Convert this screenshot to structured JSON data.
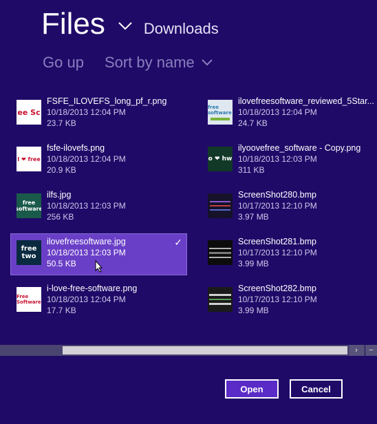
{
  "header": {
    "title": "Files",
    "location": "Downloads"
  },
  "toolbar": {
    "go_up": "Go up",
    "sort": "Sort by name"
  },
  "files_left": [
    {
      "name": "FSFE_ILOVEFS_long_pf_r.png",
      "date": "10/18/2013 12:04 PM",
      "size": "23.7 KB"
    },
    {
      "name": "fsfe-ilovefs.png",
      "date": "10/18/2013 12:04 PM",
      "size": "20.9 KB"
    },
    {
      "name": "ilfs.jpg",
      "date": "10/18/2013 12:03 PM",
      "size": "256 KB"
    },
    {
      "name": "ilovefreesoftware.jpg",
      "date": "10/18/2013 12:03 PM",
      "size": "50.5 KB"
    },
    {
      "name": "i-love-free-software.png",
      "date": "10/18/2013 12:04 PM",
      "size": "17.7 KB"
    }
  ],
  "files_right": [
    {
      "name": "ilovefreesoftware_reviewed_5Star...",
      "date": "10/18/2013 12:04 PM",
      "size": "24.7 KB"
    },
    {
      "name": "ilyoovefree_software - Copy.png",
      "date": "10/18/2013 12:03 PM",
      "size": "311 KB"
    },
    {
      "name": "ScreenShot280.bmp",
      "date": "10/17/2013 12:10 PM",
      "size": "3.97 MB"
    },
    {
      "name": "ScreenShot281.bmp",
      "date": "10/17/2013 12:10 PM",
      "size": "3.99 MB"
    },
    {
      "name": "ScreenShot282.bmp",
      "date": "10/17/2013 12:10 PM",
      "size": "3.99 MB"
    }
  ],
  "thumbs": {
    "t1": "ee Sc",
    "t2": "I ❤ free",
    "t3": "free software",
    "t4": "free two",
    "t5": "Free Software",
    "t6": "free software",
    "t7": "o ❤ hw"
  },
  "buttons": {
    "open": "Open",
    "cancel": "Cancel"
  },
  "selection": {
    "check": "✓"
  },
  "scroll": {
    "right": "›",
    "minus": "−"
  },
  "colors": {
    "background": "#1f0a68",
    "selected": "#6a3fc7",
    "accent_button": "#5a2bc6"
  }
}
